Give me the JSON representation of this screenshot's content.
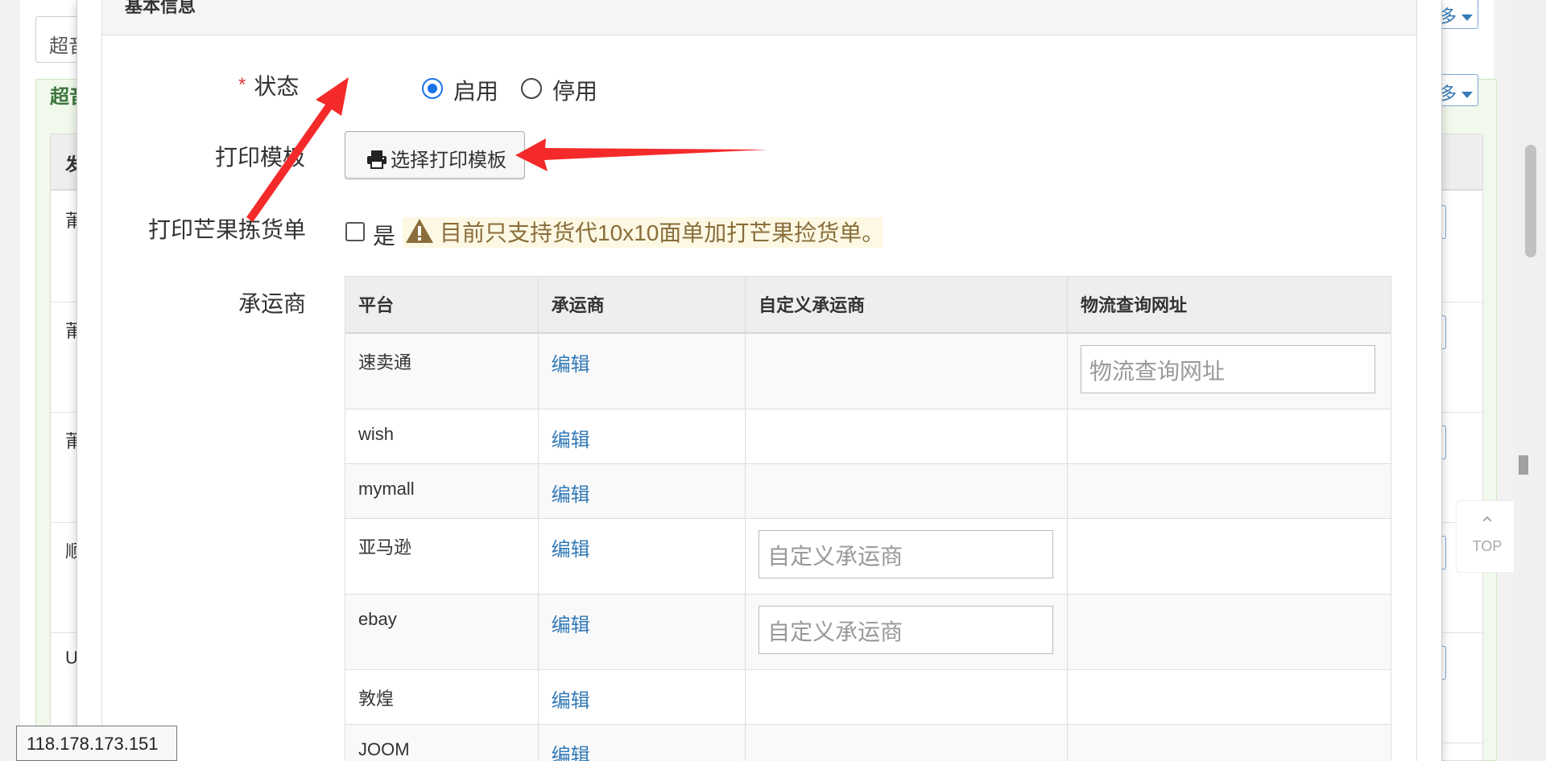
{
  "background": {
    "search_box_text": "超音",
    "panel_title": "超音",
    "table_header_first": "发",
    "row_first_chars": [
      "莆",
      "莆",
      "莆",
      "顺",
      "U"
    ],
    "more_button_label": "多"
  },
  "modal": {
    "section_title": "基本信息",
    "status": {
      "label": "状态",
      "required_mark": "*",
      "options": [
        {
          "label": "启用",
          "checked": true
        },
        {
          "label": "停用",
          "checked": false
        }
      ]
    },
    "print_template": {
      "label": "打印模板",
      "button_label": "选择打印模板"
    },
    "mango_pick": {
      "label": "打印芒果拣货单",
      "checkbox_label": "是",
      "checked": false,
      "warning": "目前只支持货代10x10面单加打芒果捡货单。"
    },
    "carriers": {
      "label": "承运商",
      "columns": [
        "平台",
        "承运商",
        "自定义承运商",
        "物流查询网址"
      ],
      "rows": [
        {
          "platform": "速卖通",
          "edit": "编辑",
          "custom_placeholder": "",
          "url_placeholder": "物流查询网址"
        },
        {
          "platform": "wish",
          "edit": "编辑",
          "custom_placeholder": "",
          "url_placeholder": ""
        },
        {
          "platform": "mymall",
          "edit": "编辑",
          "custom_placeholder": "",
          "url_placeholder": ""
        },
        {
          "platform": "亚马逊",
          "edit": "编辑",
          "custom_placeholder": "自定义承运商",
          "url_placeholder": ""
        },
        {
          "platform": "ebay",
          "edit": "编辑",
          "custom_placeholder": "自定义承运商",
          "url_placeholder": ""
        },
        {
          "platform": "敦煌",
          "edit": "编辑",
          "custom_placeholder": "",
          "url_placeholder": ""
        },
        {
          "platform": "JOOM",
          "edit": "编辑",
          "custom_placeholder": "",
          "url_placeholder": ""
        }
      ]
    }
  },
  "top_button": {
    "label": "TOP"
  },
  "ip_tooltip": "118.178.173.151",
  "colors": {
    "accent_blue": "#1a73e8",
    "link": "#337ab7",
    "warning_text": "#8a6d3b",
    "warning_bg": "#fcf8e3",
    "arrow_red": "#f42a2a",
    "panel_green_text": "#3c763d"
  }
}
